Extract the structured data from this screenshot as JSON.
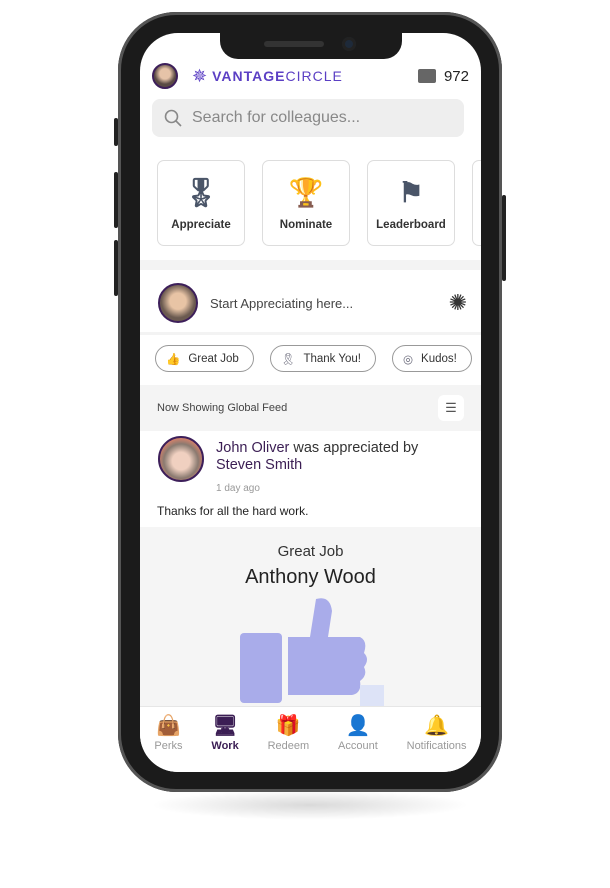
{
  "header": {
    "brand_bold": "VANTAGE",
    "brand_light": "CIRCLE",
    "points": "972"
  },
  "search": {
    "placeholder": "Search for colleagues..."
  },
  "actions": [
    {
      "label": "Appreciate",
      "icon": "ribbon-award-icon"
    },
    {
      "label": "Nominate",
      "icon": "trophy-icon"
    },
    {
      "label": "Leaderboard",
      "icon": "leaderboard-icon"
    }
  ],
  "compose": {
    "placeholder": "Start Appreciating here..."
  },
  "chips": [
    {
      "label": "Great Job",
      "icon": "thumbs-up-icon"
    },
    {
      "label": "Thank You!",
      "icon": "ribbon-icon"
    },
    {
      "label": "Kudos!",
      "icon": "kudos-badge-icon"
    }
  ],
  "feed": {
    "label": "Now Showing Global Feed"
  },
  "post": {
    "recipient": "John Oliver",
    "verb": "was appreciated by",
    "sender": "Steven Smith",
    "time": "1 day ago",
    "message": "Thanks for all the hard work.",
    "card_title": "Great Job",
    "card_name": "Anthony Wood"
  },
  "nav": [
    {
      "label": "Perks",
      "icon": "shopping-bag-icon"
    },
    {
      "label": "Work",
      "icon": "work-monitor-icon",
      "active": true
    },
    {
      "label": "Redeem",
      "icon": "gift-icon"
    },
    {
      "label": "Account",
      "icon": "person-icon"
    },
    {
      "label": "Notifications",
      "icon": "bell-icon"
    }
  ],
  "colors": {
    "brand": "#5b3fc4",
    "accent": "#3b1e54"
  }
}
